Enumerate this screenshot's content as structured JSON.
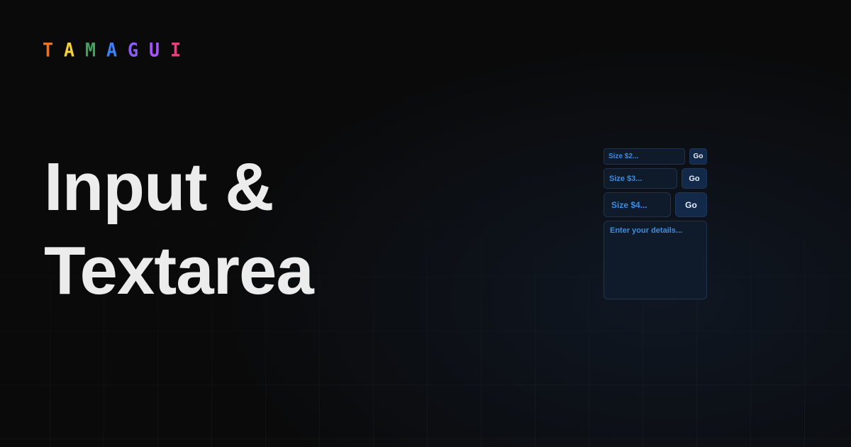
{
  "logo": {
    "letters": [
      {
        "char": "T",
        "color": "#e8742c"
      },
      {
        "char": "A",
        "color": "#f2d13a"
      },
      {
        "char": "M",
        "color": "#3fa35b"
      },
      {
        "char": "A",
        "color": "#3b82f6"
      },
      {
        "char": "G",
        "color": "#8b5cf6"
      },
      {
        "char": "U",
        "color": "#a855f7"
      },
      {
        "char": "I",
        "color": "#e0447c"
      }
    ]
  },
  "headline": {
    "line1": "Input &",
    "line2": "Textarea"
  },
  "demo": {
    "rows": [
      {
        "placeholder": "Size $2...",
        "button": "Go"
      },
      {
        "placeholder": "Size $3...",
        "button": "Go"
      },
      {
        "placeholder": "Size $4...",
        "button": "Go"
      }
    ],
    "textarea_placeholder": "Enter your details..."
  },
  "colors": {
    "background": "#0a0a0a",
    "headline_text": "#ececec",
    "placeholder_text": "#3d8de0",
    "field_background": "#0f1a2a",
    "button_background": "#13294a"
  }
}
